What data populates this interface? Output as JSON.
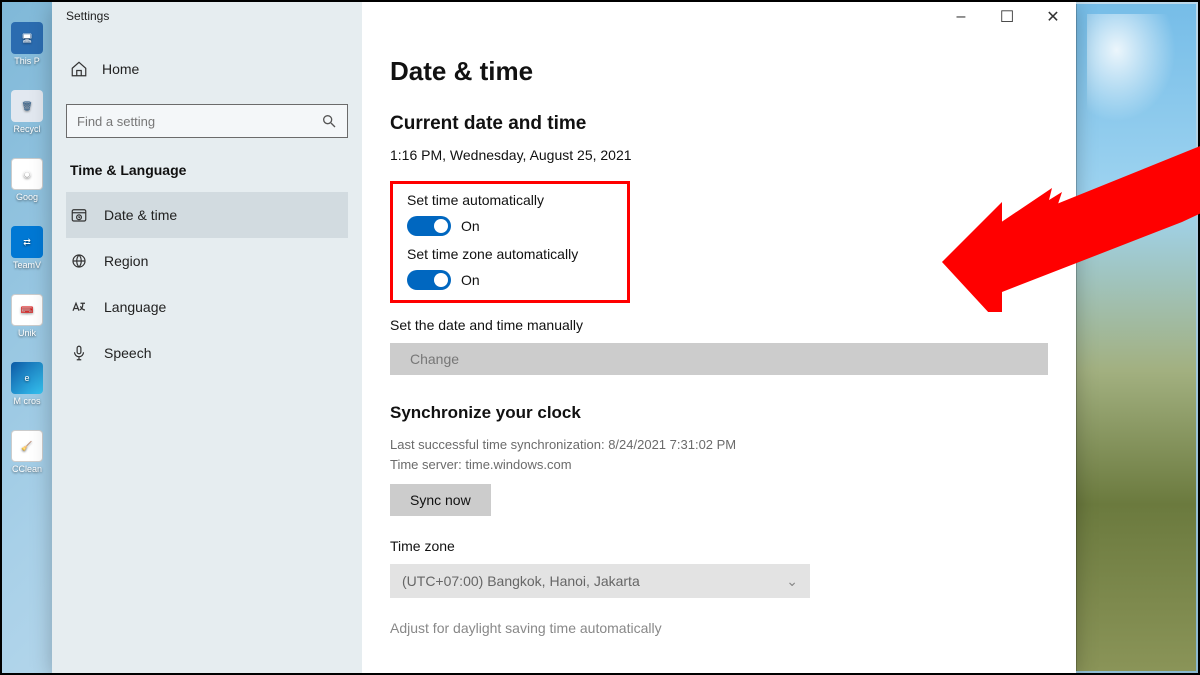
{
  "desktop": {
    "icons": [
      {
        "label": "This P"
      },
      {
        "label": "Recycl"
      },
      {
        "label": "Goog"
      },
      {
        "label": "TeamV"
      },
      {
        "label": "Unik"
      },
      {
        "label": "M cros"
      },
      {
        "label": "CClean"
      }
    ]
  },
  "window": {
    "title": "Settings",
    "controls": {
      "minimize": "–",
      "maximize": "☐",
      "close": "✕"
    }
  },
  "sidebar": {
    "home_label": "Home",
    "search_placeholder": "Find a setting",
    "category_label": "Time & Language",
    "items": [
      {
        "icon": "clock",
        "label": "Date & time",
        "active": true
      },
      {
        "icon": "globe",
        "label": "Region",
        "active": false
      },
      {
        "icon": "language",
        "label": "Language",
        "active": false
      },
      {
        "icon": "mic",
        "label": "Speech",
        "active": false
      }
    ]
  },
  "content": {
    "page_title": "Date & time",
    "current_section": "Current date and time",
    "current_value": "1:16 PM, Wednesday, August 25, 2021",
    "toggle_auto_time": {
      "label": "Set time automatically",
      "state": "On"
    },
    "toggle_auto_tz": {
      "label": "Set time zone automatically",
      "state": "On"
    },
    "manual_label": "Set the date and time manually",
    "change_button": "Change",
    "sync_section": "Synchronize your clock",
    "sync_last": "Last successful time synchronization: 8/24/2021 7:31:02 PM",
    "sync_server": "Time server: time.windows.com",
    "sync_button": "Sync now",
    "tz_section": "Time zone",
    "tz_value": "(UTC+07:00) Bangkok, Hanoi, Jakarta",
    "dst_label": "Adjust for daylight saving time automatically"
  },
  "annotation": {
    "type": "red-arrow-highlight"
  }
}
